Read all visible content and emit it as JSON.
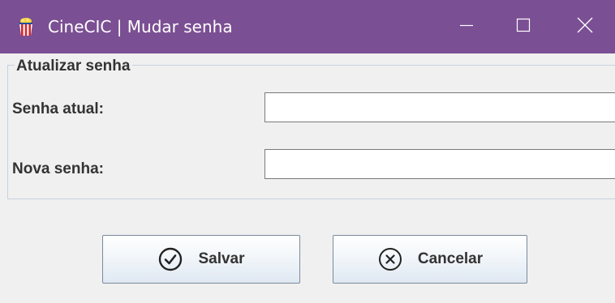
{
  "window": {
    "title": "CineCIC | Mudar senha",
    "icon": "app-logo-icon",
    "controls": {
      "minimize_icon": "minimize-icon",
      "maximize_icon": "maximize-icon",
      "close_icon": "close-icon"
    },
    "title_bar_color": "#7b4f93"
  },
  "form": {
    "group_title": "Atualizar senha",
    "current_password": {
      "label": "Senha atual:",
      "value": ""
    },
    "new_password": {
      "label": "Nova senha:",
      "value": ""
    }
  },
  "actions": {
    "save": {
      "label": "Salvar",
      "icon": "check-circle-icon"
    },
    "cancel": {
      "label": "Cancelar",
      "icon": "x-circle-icon"
    }
  }
}
